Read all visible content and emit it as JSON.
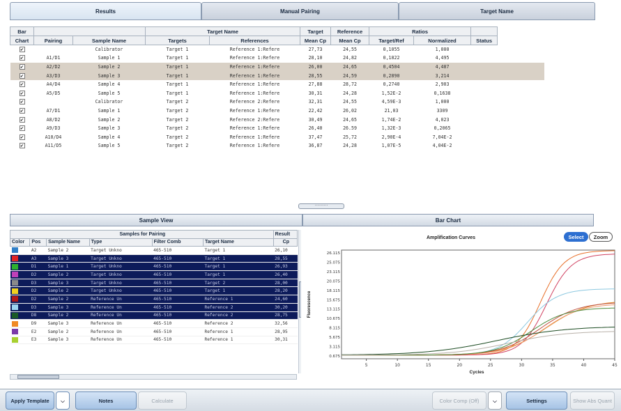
{
  "tabs": [
    "Results",
    "Manual Pairing",
    "Target Name"
  ],
  "results": {
    "group_headers": {
      "bar": "Bar",
      "target_name": "Target Name",
      "target": "Target",
      "reference": "Reference",
      "ratios": "Ratios"
    },
    "columns": [
      "Chart",
      "Pairing",
      "Sample Name",
      "Targets",
      "References",
      "Mean Cp",
      "Mean Cp",
      "Target/Ref",
      "Normalized",
      "Status"
    ],
    "rows": [
      {
        "checked": "✔",
        "pairing": "",
        "sample": "Calibrator",
        "target": "Target 1",
        "ref": "Reference 1:Refere",
        "tcp": "27,73",
        "rcp": "24,55",
        "ratio": "0,1055",
        "norm": "1,000",
        "sel": false
      },
      {
        "checked": "✔",
        "pairing": "A1/D1",
        "sample": "Sample 1",
        "target": "Target 1",
        "ref": "Reference 1:Refere",
        "tcp": "28,10",
        "rcp": "24,82",
        "ratio": "0,1822",
        "norm": "4,495",
        "sel": false
      },
      {
        "checked": "✔",
        "pairing": "A2/D2",
        "sample": "Sample 2",
        "target": "Target 1",
        "ref": "Reference 1:Refere",
        "tcp": "26,00",
        "rcp": "24,65",
        "ratio": "0,4504",
        "norm": "4,487",
        "sel": true
      },
      {
        "checked": "✔",
        "pairing": "A3/D3",
        "sample": "Sample 3",
        "target": "Target 1",
        "ref": "Reference 1:Refere",
        "tcp": "28,55",
        "rcp": "24,59",
        "ratio": "0,2890",
        "norm": "3,214",
        "sel": true
      },
      {
        "checked": "✔",
        "pairing": "A4/D4",
        "sample": "Sample 4",
        "target": "Target 1",
        "ref": "Reference 1:Refere",
        "tcp": "27,88",
        "rcp": "28,72",
        "ratio": "0,2740",
        "norm": "2,903",
        "sel": false
      },
      {
        "checked": "✔",
        "pairing": "A5/D5",
        "sample": "Sample 5",
        "target": "Target 1",
        "ref": "Reference 1:Refere",
        "tcp": "30,31",
        "rcp": "24,28",
        "ratio": "1,52E-2",
        "norm": "0,1638",
        "sel": false
      },
      {
        "checked": "✔",
        "pairing": "",
        "sample": "Calibrator",
        "target": "Target 2",
        "ref": "Reference 2:Refere",
        "tcp": "32,31",
        "rcp": "24,55",
        "ratio": "4,59E-3",
        "norm": "1,000",
        "sel": false
      },
      {
        "checked": "✔",
        "pairing": "A7/D1",
        "sample": "Sample 1",
        "target": "Target 2",
        "ref": "Reference 1:Refere",
        "tcp": "22,42",
        "rcp": "26,02",
        "ratio": "21,03",
        "norm": "3309",
        "sel": false
      },
      {
        "checked": "✔",
        "pairing": "A8/D2",
        "sample": "Sample 2",
        "target": "Target 2",
        "ref": "Reference 2:Refere",
        "tcp": "30,49",
        "rcp": "24,65",
        "ratio": "1,74E-2",
        "norm": "4,023",
        "sel": false
      },
      {
        "checked": "✔",
        "pairing": "A9/D3",
        "sample": "Sample 3",
        "target": "Target 2",
        "ref": "Reference 1:Refere",
        "tcp": "26,40",
        "rcp": "26.59",
        "ratio": "1,32E-3",
        "norm": "0,2065",
        "sel": false
      },
      {
        "checked": "✔",
        "pairing": "A10/D4",
        "sample": "Sample 4",
        "target": "Target 2",
        "ref": "Reference 1:Refere",
        "tcp": "37,47",
        "rcp": "25,72",
        "ratio": "2,90E-4",
        "norm": "7,04E-2",
        "sel": false
      },
      {
        "checked": "✔",
        "pairing": "A11/D5",
        "sample": "Sample 5",
        "target": "Target 2",
        "ref": "Reference 1:Refere",
        "tcp": "36,87",
        "rcp": "24,28",
        "ratio": "1,07E-5",
        "norm": "4,04E-2",
        "sel": false
      }
    ]
  },
  "scroll_grip": "··········",
  "sample_view": {
    "title": "Sample View",
    "group_header": "Samples for Pairing",
    "result_header": "Result",
    "columns": [
      "Color",
      "Pos",
      "Sample Name",
      "Type",
      "Filter Comb",
      "Target Name",
      "Cp"
    ],
    "rows": [
      {
        "color": "#2f7fc8",
        "pos": "A2",
        "sample": "Sample 2",
        "type": "Target Unkno",
        "filter": "465-510",
        "target": "Target 1",
        "cp": "26,10",
        "dark": false
      },
      {
        "color": "#e02424",
        "pos": "A3",
        "sample": "Sample 3",
        "type": "Target Unkno",
        "filter": "465-510",
        "target": "Target 1",
        "cp": "28,55",
        "dark": true
      },
      {
        "color": "#2eb02e",
        "pos": "D1",
        "sample": "Sample 1",
        "type": "Target Unkno",
        "filter": "465-510",
        "target": "Target 1",
        "cp": "26,93",
        "dark": true
      },
      {
        "color": "#c040b8",
        "pos": "D2",
        "sample": "Sample 2",
        "type": "Target Unkno",
        "filter": "465-510",
        "target": "Target 1",
        "cp": "26,40",
        "dark": true
      },
      {
        "color": "#8a8a8a",
        "pos": "D3",
        "sample": "Sample 3",
        "type": "Target Unkno",
        "filter": "465-510",
        "target": "Target 2",
        "cp": "28,00",
        "dark": true
      },
      {
        "color": "#f0d020",
        "pos": "D2",
        "sample": "Sample 2",
        "type": "Target Unkno",
        "filter": "465-510",
        "target": "Target 1",
        "cp": "28,20",
        "dark": true
      },
      {
        "color": "#b01818",
        "pos": "D2",
        "sample": "Sample 2",
        "type": "Reference Un",
        "filter": "465-510",
        "target": "Reference 1",
        "cp": "24,60",
        "dark": true
      },
      {
        "color": "#9ed6f0",
        "pos": "D3",
        "sample": "Sample 3",
        "type": "Reference Un",
        "filter": "465-510",
        "target": "Reference 2",
        "cp": "30,20",
        "dark": true
      },
      {
        "color": "#1a5a28",
        "pos": "D8",
        "sample": "Sample 2",
        "type": "Reference Un",
        "filter": "465-510",
        "target": "Reference 2",
        "cp": "28,75",
        "dark": true
      },
      {
        "color": "#f08a24",
        "pos": "D9",
        "sample": "Sample 3",
        "type": "Reference Un",
        "filter": "465-510",
        "target": "Reference 2",
        "cp": "32,56",
        "dark": false
      },
      {
        "color": "#7a3aa8",
        "pos": "E2",
        "sample": "Sample 2",
        "type": "Reference Un",
        "filter": "465-510",
        "target": "Reference 1",
        "cp": "28,95",
        "dark": false
      },
      {
        "color": "#a8d030",
        "pos": "E3",
        "sample": "Sample 3",
        "type": "Reference Un",
        "filter": "465-510",
        "target": "Reference 1",
        "cp": "30,31",
        "dark": false
      }
    ]
  },
  "bar_chart": {
    "tab_label": "Bar Chart",
    "select_label": "Select",
    "zoom_label": "Zoom"
  },
  "chart_data": {
    "type": "line",
    "title": "Amplification Curves",
    "xlabel": "Cycles",
    "ylabel": "Fluorescence",
    "xticks": [
      5,
      10,
      15,
      20,
      25,
      30,
      35,
      40,
      45
    ],
    "yticks": [
      "26.115",
      "25.075",
      "23.115",
      "20.075",
      "18.115",
      "15.675",
      "13.115",
      "10.675",
      "8.115",
      "5.675",
      "3.115",
      "0.675"
    ],
    "xlim": [
      1,
      45
    ],
    "ylim": [
      0,
      27
    ],
    "series": [
      {
        "color": "#e8702a",
        "plateau": 26.0,
        "mid": 33.0,
        "k": 0.52
      },
      {
        "color": "#d04060",
        "plateau": 25.2,
        "mid": 34.0,
        "k": 0.5
      },
      {
        "color": "#8cc8e0",
        "plateau": 16.5,
        "mid": 31.0,
        "k": 0.42
      },
      {
        "color": "#e0902a",
        "plateau": 13.6,
        "mid": 34.0,
        "k": 0.3
      },
      {
        "color": "#c05040",
        "plateau": 13.2,
        "mid": 33.0,
        "k": 0.32
      },
      {
        "color": "#f09a70",
        "plateau": 12.8,
        "mid": 33.5,
        "k": 0.33
      },
      {
        "color": "#4a8a3a",
        "plateau": 11.8,
        "mid": 31.5,
        "k": 0.35
      },
      {
        "color": "#1a4a20",
        "plateau": 7.2,
        "mid": 26.0,
        "k": 0.18
      },
      {
        "color": "#b8b0a8",
        "plateau": 6.0,
        "mid": 28.0,
        "k": 0.22
      }
    ]
  },
  "toolbar": {
    "apply_template": "Apply Template",
    "notes": "Notes",
    "calculate": "Calculate",
    "color_comp": "Color Comp (Off)",
    "settings": "Settings",
    "show_abs": "Show Abs Quant"
  }
}
